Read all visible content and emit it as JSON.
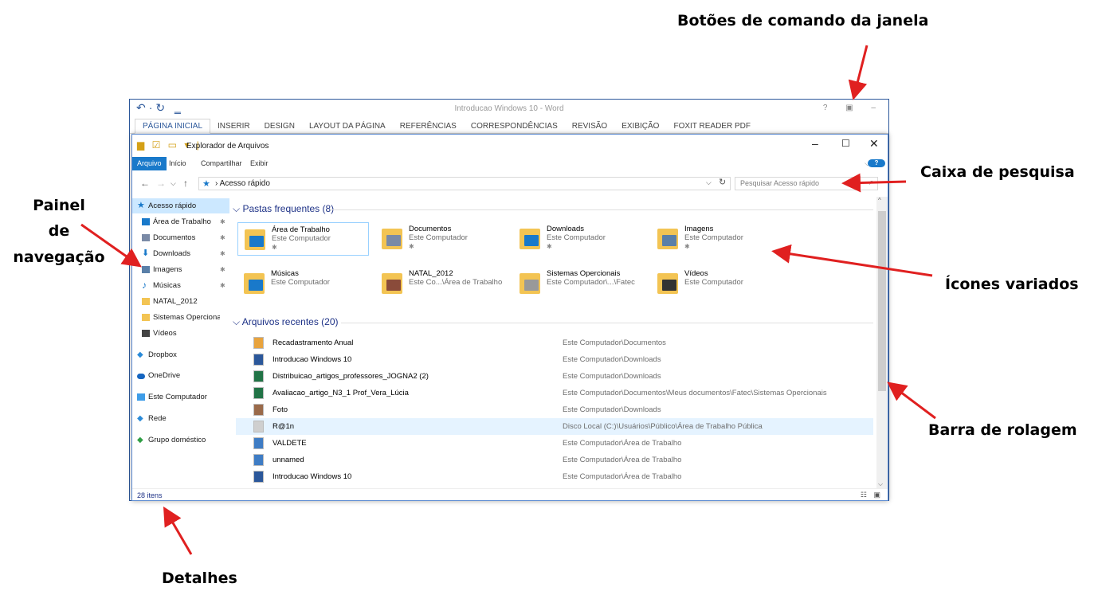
{
  "annotations": {
    "window_buttons": "Botões de comando da janela",
    "search_box": "Caixa de pesquisa",
    "nav_pane": [
      "Painel",
      "de",
      "navegação"
    ],
    "icons": "Ícones variados",
    "scrollbar": "Barra de rolagem",
    "details": "Detalhes"
  },
  "word": {
    "title": "Introducao Windows 10 - Word",
    "tabs": [
      "PÁGINA INICIAL",
      "INSERIR",
      "DESIGN",
      "LAYOUT DA PÁGINA",
      "REFERÊNCIAS",
      "CORRESPONDÊNCIAS",
      "REVISÃO",
      "EXIBIÇÃO",
      "FOXIT READER PDF"
    ]
  },
  "explorer": {
    "title": "Explorador de Arquivos",
    "menu": [
      "Arquivo",
      "Início",
      "Compartilhar",
      "Exibir"
    ],
    "address": "Acesso rápido",
    "search_placeholder": "Pesquisar Acesso rápido",
    "nav": [
      {
        "label": "Acesso rápido",
        "icon": "star-icon",
        "color": "#1979ca"
      },
      {
        "label": "Área de Trabalho",
        "icon": "desktop-icon",
        "color": "#1979ca",
        "pinned": true
      },
      {
        "label": "Documentos",
        "icon": "document-icon",
        "color": "#7a8aa6",
        "pinned": true
      },
      {
        "label": "Downloads",
        "icon": "download-arrow-icon",
        "color": "#1979ca",
        "pinned": true
      },
      {
        "label": "Imagens",
        "icon": "picture-icon",
        "color": "#5a7fa8",
        "pinned": true
      },
      {
        "label": "Músicas",
        "icon": "music-note-icon",
        "color": "#1979ca",
        "pinned": true
      },
      {
        "label": "NATAL_2012",
        "icon": "folder-icon",
        "color": "#f3c453"
      },
      {
        "label": "Sistemas Opercionais",
        "icon": "folder-icon",
        "color": "#f3c453"
      },
      {
        "label": "Vídeos",
        "icon": "film-icon",
        "color": "#444444"
      },
      {
        "label": "Dropbox",
        "icon": "dropbox-icon",
        "color": "#2a8ad8"
      },
      {
        "label": "OneDrive",
        "icon": "cloud-icon",
        "color": "#1565c0"
      },
      {
        "label": "Este Computador",
        "icon": "computer-icon",
        "color": "#3e9de8"
      },
      {
        "label": "Rede",
        "icon": "network-icon",
        "color": "#2a8ad8"
      },
      {
        "label": "Grupo doméstico",
        "icon": "homegroup-icon",
        "color": "#2f9e44"
      }
    ],
    "frequent_header": "Pastas frequentes (8)",
    "frequent": [
      {
        "name": "Área de Trabalho",
        "sub": "Este Computador",
        "pinned": true,
        "icon": "desktop-folder-icon",
        "color": "#1979ca"
      },
      {
        "name": "Documentos",
        "sub": "Este Computador",
        "pinned": true,
        "icon": "documents-folder-icon",
        "color": "#7a8aa6"
      },
      {
        "name": "Downloads",
        "sub": "Este Computador",
        "pinned": true,
        "icon": "downloads-folder-icon",
        "color": "#1979ca"
      },
      {
        "name": "Imagens",
        "sub": "Este Computador",
        "pinned": true,
        "icon": "pictures-folder-icon",
        "color": "#5a7fa8"
      },
      {
        "name": "Músicas",
        "sub": "Este Computador",
        "pinned": false,
        "icon": "music-folder-icon",
        "color": "#1979ca"
      },
      {
        "name": "NATAL_2012",
        "sub": "Este Co...\\Área de Trabalho",
        "pinned": false,
        "icon": "photo-folder-icon",
        "color": "#8a4b3a"
      },
      {
        "name": "Sistemas Opercionais",
        "sub": "Este Computador\\...\\Fatec",
        "pinned": false,
        "icon": "docs-folder-icon",
        "color": "#999999"
      },
      {
        "name": "Vídeos",
        "sub": "Este Computador",
        "pinned": false,
        "icon": "videos-folder-icon",
        "color": "#333333"
      }
    ],
    "recent_header": "Arquivos recentes (20)",
    "recent": [
      {
        "name": "Recadastramento Anual",
        "path": "Este Computador\\Documentos",
        "icon": "pdf-file-icon",
        "color": "#e8a33d"
      },
      {
        "name": "Introducao Windows 10",
        "path": "Este Computador\\Downloads",
        "icon": "word-file-icon",
        "color": "#2b579a"
      },
      {
        "name": "Distribuicao_artigos_professores_JOGNA2 (2)",
        "path": "Este Computador\\Downloads",
        "icon": "excel-file-icon",
        "color": "#217346"
      },
      {
        "name": "Avaliacao_artigo_N3_1 Prof_Vera_Lúcia",
        "path": "Este Computador\\Documentos\\Meus documentos\\Fatec\\Sistemas Opercionais",
        "icon": "excel-file-icon",
        "color": "#217346"
      },
      {
        "name": "Foto",
        "path": "Este Computador\\Downloads",
        "icon": "photo-file-icon",
        "color": "#9a6a4a"
      },
      {
        "name": "R@1n",
        "path": "Disco Local (C:)\\Usuários\\Público\\Área de Trabalho Pública",
        "icon": "blank-file-icon",
        "color": "#cfcfcf"
      },
      {
        "name": "VALDETE",
        "path": "Este Computador\\Área de Trabalho",
        "icon": "image-file-icon",
        "color": "#3e7cc4"
      },
      {
        "name": "unnamed",
        "path": "Este Computador\\Área de Trabalho",
        "icon": "image-file-icon",
        "color": "#3e7cc4"
      },
      {
        "name": "Introducao Windows 10",
        "path": "Este Computador\\Área de Trabalho",
        "icon": "word-file-icon",
        "color": "#2b579a"
      }
    ],
    "status": "28 itens"
  }
}
